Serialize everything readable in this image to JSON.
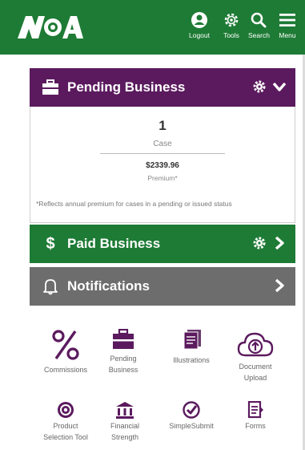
{
  "header": {
    "logo_text": "NOA",
    "buttons": [
      {
        "label": "Logout",
        "icon": "user-icon"
      },
      {
        "label": "Tools",
        "icon": "gear-icon"
      },
      {
        "label": "Search",
        "icon": "search-icon"
      },
      {
        "label": "Menu",
        "icon": "hamburger-icon"
      }
    ],
    "color": "#1e7b35"
  },
  "pending": {
    "title": "Pending Business",
    "count": "1",
    "count_label": "Case",
    "premium": "$2339.96",
    "premium_label": "Premium*",
    "footnote": "*Reflects annual premium for cases in a pending or issued status",
    "color": "#5b1a5e"
  },
  "paid": {
    "title": "Paid Business",
    "color": "#1e7b35"
  },
  "notifications": {
    "title": "Notifications",
    "color": "#6d6d6d"
  },
  "tiles": [
    {
      "label_1": "Commissions",
      "label_2": "",
      "icon": "percent-icon"
    },
    {
      "label_1": "Pending",
      "label_2": "Business",
      "icon": "briefcase-icon"
    },
    {
      "label_1": "Illustrations",
      "label_2": "",
      "icon": "document-stack-icon"
    },
    {
      "label_1": "Document",
      "label_2": "Upload",
      "icon": "cloud-upload-icon"
    },
    {
      "label_1": "Product",
      "label_2": "Selection Tool",
      "icon": "target-icon"
    },
    {
      "label_1": "Financial",
      "label_2": "Strength",
      "icon": "bank-icon"
    },
    {
      "label_1": "SimpleSubmit",
      "label_2": "",
      "icon": "checkmark-circle-icon"
    },
    {
      "label_1": "Forms",
      "label_2": "",
      "icon": "forms-icon"
    }
  ],
  "icon_color": "#5b1a5e"
}
